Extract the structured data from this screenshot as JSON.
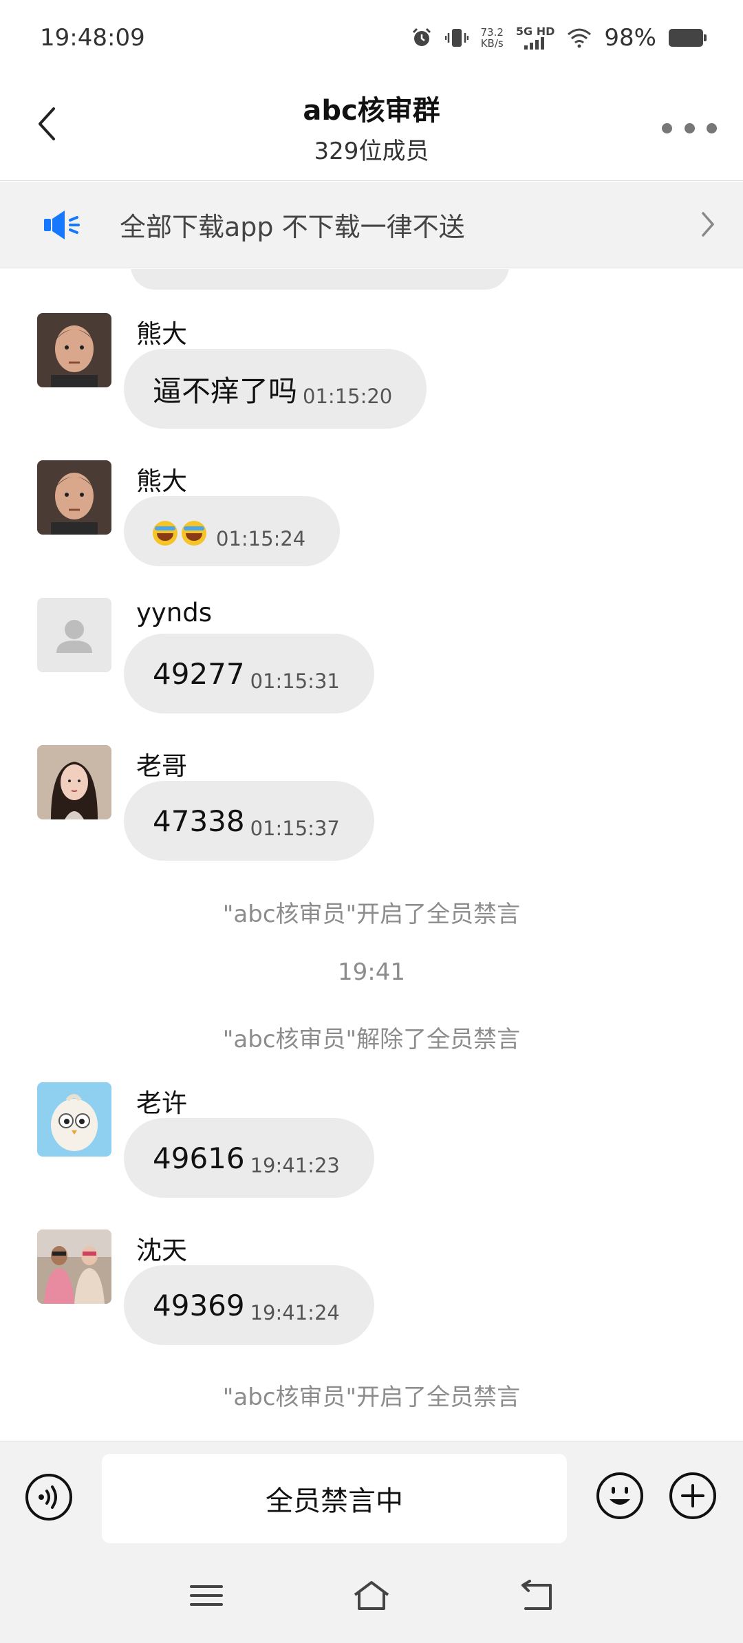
{
  "status_bar": {
    "time": "19:48:09",
    "net_speed_value": "73.2",
    "net_speed_unit": "KB/s",
    "network": "5G HD",
    "battery": "98%"
  },
  "header": {
    "title": "abc核审群",
    "subtitle": "329位成员"
  },
  "notice": {
    "text": "全部下载app 不下载一律不送"
  },
  "messages": [
    {
      "sender": "熊大",
      "content": "逼不痒了吗",
      "time": "01:15:20"
    },
    {
      "sender": "熊大",
      "content": "",
      "emoji_count": 2,
      "time": "01:15:24"
    },
    {
      "sender": "yynds",
      "content": "49277",
      "time": "01:15:31"
    },
    {
      "sender": "老哥",
      "content": "47338",
      "time": "01:15:37"
    },
    {
      "sender": "老许",
      "content": "49616",
      "time": "19:41:23"
    },
    {
      "sender": "沈天",
      "content": "49369",
      "time": "19:41:24"
    }
  ],
  "system": {
    "mute_on_1": "\"abc核审员\"开启了全员禁言",
    "timestamp": "19:41",
    "mute_off": "\"abc核审员\"解除了全员禁言",
    "mute_on_2": "\"abc核审员\"开启了全员禁言"
  },
  "input": {
    "mute_label": "全员禁言中"
  },
  "colors": {
    "accent_blue": "#1677ff",
    "bubble_bg": "#ebebeb",
    "system_text": "#8c8c8c"
  }
}
